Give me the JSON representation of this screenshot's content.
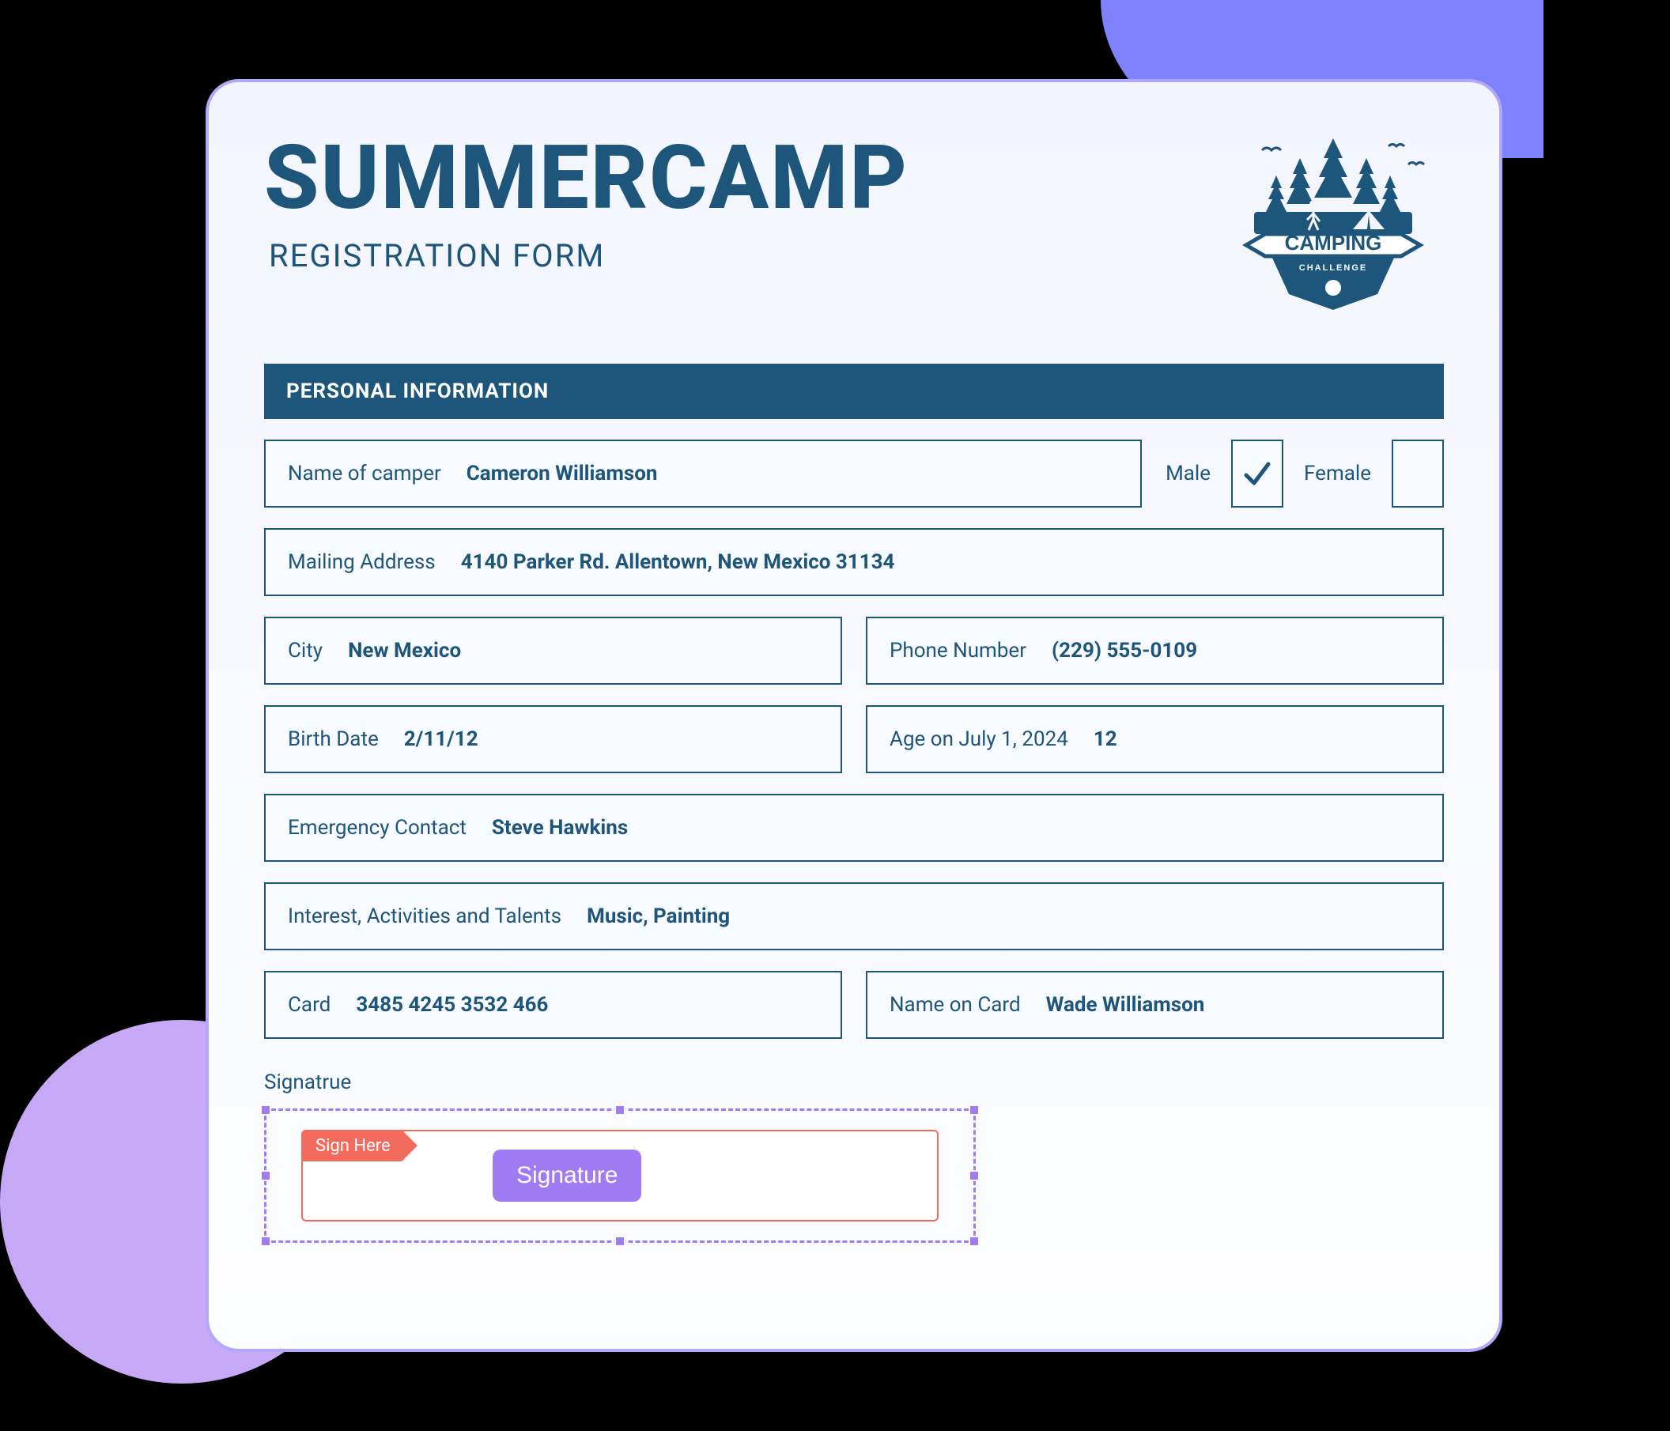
{
  "header": {
    "title": "SUMMERCAMP",
    "subtitle": "REGISTRATION FORM",
    "logo_text": "CAMPING",
    "logo_subtext": "CHALLENGE"
  },
  "section_title": "PERSONAL INFORMATION",
  "fields": {
    "name_label": "Name of camper",
    "name_value": "Cameron Williamson",
    "male_label": "Male",
    "female_label": "Female",
    "male_checked": true,
    "female_checked": false,
    "address_label": "Mailing Address",
    "address_value": "4140 Parker Rd. Allentown, New Mexico 31134",
    "city_label": "City",
    "city_value": "New Mexico",
    "phone_label": "Phone Number",
    "phone_value": "(229) 555-0109",
    "birth_label": "Birth Date",
    "birth_value": "2/11/12",
    "age_label": "Age on July 1, 2024",
    "age_value": "12",
    "emergency_label": "Emergency Contact",
    "emergency_value": "Steve Hawkins",
    "interests_label": "Interest, Activities and Talents",
    "interests_value": "Music, Painting",
    "card_label": "Card",
    "card_value": "3485 4245 3532 466",
    "cardname_label": "Name on Card",
    "cardname_value": "Wade Williamson"
  },
  "signature": {
    "label": "Signatrue",
    "tag": "Sign Here",
    "button": "Signature"
  }
}
